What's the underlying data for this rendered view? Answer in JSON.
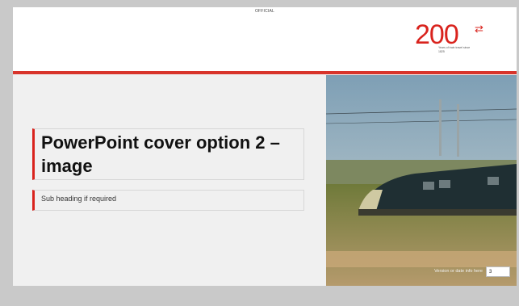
{
  "slide": {
    "classification": "OFFICIAL",
    "logo": {
      "number": "200",
      "tagline": "Years of train travel since 1825"
    },
    "title": "PowerPoint cover option 2 – image",
    "subheading": "Sub heading if required",
    "photo_subject": "train-photo",
    "version_label": "Version or date info here",
    "version_value": "3"
  },
  "colors": {
    "accent_red": "#d9231d",
    "background": "#c9c9c9",
    "slide_background": "#f0f0f0"
  }
}
